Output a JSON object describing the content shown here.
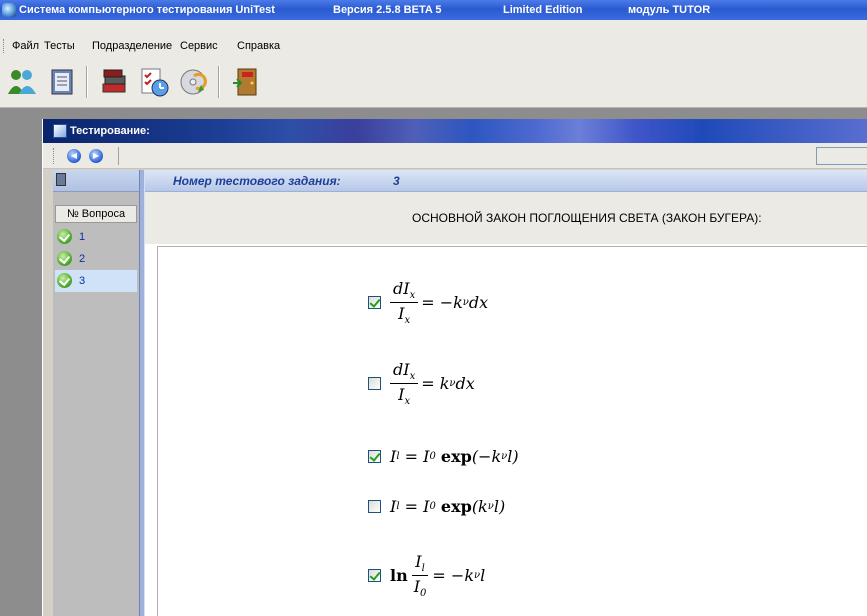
{
  "window": {
    "title_app": "Система компьютерного тестирования UniTest",
    "title_version": "Версия 2.5.8 BETA 5",
    "title_edition": "Limited Edition",
    "title_module": "модуль TUTOR"
  },
  "menu": {
    "file": "Файл",
    "tests": "Тесты",
    "division": "Подразделение",
    "service": "Сервис",
    "help": "Справка"
  },
  "toolbar": {
    "icons": [
      "users-icon",
      "notebook-icon",
      "book-stack-icon",
      "checklist-clock-icon",
      "cd-refresh-icon",
      "exit-door-icon"
    ]
  },
  "child_window": {
    "title": "Тестирование:"
  },
  "left_panel": {
    "column_header": "№ Вопроса",
    "questions": [
      {
        "number": "1",
        "answered": true
      },
      {
        "number": "2",
        "answered": true
      },
      {
        "number": "3",
        "answered": true,
        "selected": true
      }
    ]
  },
  "question": {
    "label": "Номер тестового задания:",
    "number": "3",
    "topic": "ОСНОВНОЙ ЗАКОН ПОГЛОЩЕНИЯ СВЕТА (ЗАКОН БУГЕРА):"
  },
  "answers": [
    {
      "id": "a1",
      "checked": true,
      "formula": "dIx/Ix = −kν dx"
    },
    {
      "id": "a2",
      "checked": false,
      "formula": "dIx/Ix = kν dx"
    },
    {
      "id": "a3",
      "checked": true,
      "formula": "Il = I0 exp(−kν l)"
    },
    {
      "id": "a4",
      "checked": false,
      "formula": "Il = I0 exp(kν l)"
    },
    {
      "id": "a5",
      "checked": true,
      "formula": "ln Il/I0 = −kν l"
    }
  ],
  "colors": {
    "title_bar": "#2a5ad0",
    "question_header_text": "#1f3f96",
    "question_link": "#0b2fa5"
  }
}
